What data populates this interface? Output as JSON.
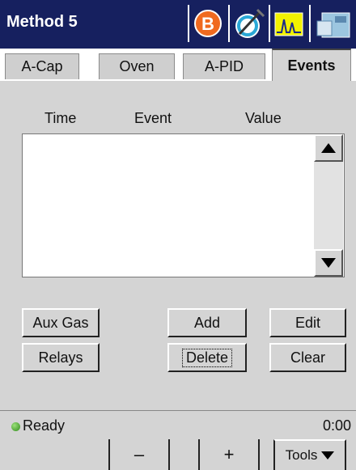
{
  "window": {
    "title": "Method 5"
  },
  "title_icons": [
    "b-badge-icon",
    "syringe-column-icon",
    "chromatogram-icon",
    "instrument-icon"
  ],
  "tabs": [
    {
      "label": "A-Cap",
      "active": false
    },
    {
      "label": "Oven",
      "active": false
    },
    {
      "label": "A-PID",
      "active": false
    },
    {
      "label": "Events",
      "active": true
    }
  ],
  "events_table": {
    "columns": [
      "Time",
      "Event",
      "Value"
    ],
    "rows": []
  },
  "buttons": {
    "aux_gas": "Aux Gas",
    "add": "Add",
    "edit": "Edit",
    "relays": "Relays",
    "delete": "Delete",
    "clear": "Clear"
  },
  "status": {
    "text": "Ready",
    "time": "0:00",
    "indicator_color": "#3fa52a"
  },
  "toolbar": {
    "minus": "–",
    "plus": "+",
    "tools": "Tools"
  },
  "colors": {
    "titlebar": "#16205f",
    "panel": "#d4d4d4"
  }
}
